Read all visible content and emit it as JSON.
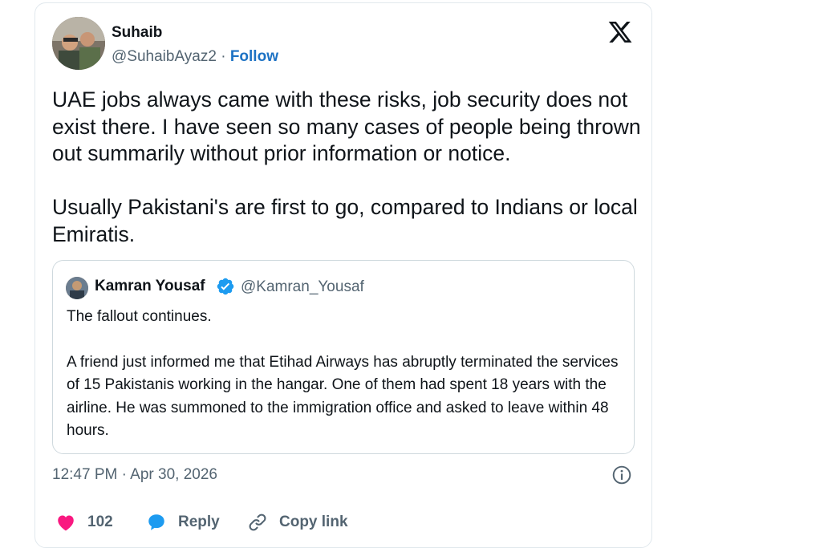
{
  "author": {
    "name": "Suhaib",
    "handle": "@SuhaibAyaz2",
    "separator": "·",
    "follow_label": "Follow"
  },
  "tweet": {
    "paragraphs": [
      "UAE jobs always came with these risks, job security does not exist there. I have seen so many cases of people being thrown out summarily without prior information or notice.",
      "Usually Pakistani's are first to go, compared to Indians or local Emiratis."
    ]
  },
  "quoted": {
    "name": "Kamran Yousaf",
    "handle": "@Kamran_Yousaf",
    "verified": true,
    "paragraphs": [
      "The fallout continues.",
      "A friend just informed me that Etihad Airways has abruptly terminated the services of 15 Pakistanis working in the hangar. One of them had spent 18 years with the airline. He was summoned to the immigration office and asked to leave within 48 hours."
    ]
  },
  "meta": {
    "timestamp": "12:47 PM · Apr 30, 2026"
  },
  "actions": {
    "like_count": "102",
    "reply_label": "Reply",
    "copy_label": "Copy link"
  },
  "icons": {
    "logo": "x-logo-icon",
    "info": "info-icon",
    "like": "heart-icon",
    "reply": "reply-bubble-icon",
    "copy": "link-icon",
    "verified": "verified-badge-icon"
  },
  "colors": {
    "link_blue": "#1d72c4",
    "verified_blue": "#1d9bf0",
    "like_red": "#f91880",
    "muted": "#536471"
  }
}
